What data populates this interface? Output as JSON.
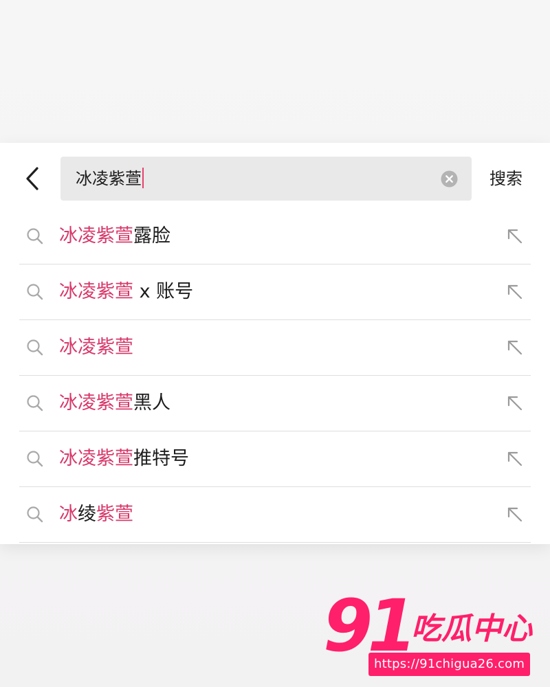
{
  "search": {
    "query": "冰凌紫萱",
    "submit_label": "搜索"
  },
  "suggestions": [
    {
      "segments": [
        {
          "text": "冰凌紫萱",
          "hl": true
        },
        {
          "text": "露脸",
          "hl": false
        }
      ]
    },
    {
      "segments": [
        {
          "text": "冰凌紫萱",
          "hl": true
        },
        {
          "text": " x 账号",
          "hl": false
        }
      ]
    },
    {
      "segments": [
        {
          "text": "冰凌紫萱",
          "hl": true
        }
      ]
    },
    {
      "segments": [
        {
          "text": "冰凌紫萱",
          "hl": true
        },
        {
          "text": "黑人",
          "hl": false
        }
      ]
    },
    {
      "segments": [
        {
          "text": "冰凌紫萱",
          "hl": true
        },
        {
          "text": "推特号",
          "hl": false
        }
      ]
    },
    {
      "segments": [
        {
          "text": "冰",
          "hl": true
        },
        {
          "text": "绫",
          "hl": false
        },
        {
          "text": "紫萱",
          "hl": true
        }
      ]
    }
  ],
  "watermark": {
    "logo_number": "91",
    "logo_text": "吃瓜中心",
    "url": "https://91chigua26.com"
  },
  "colors": {
    "highlight": "#d7386a",
    "text": "#1c1c1c",
    "field_bg": "#e9e9ea",
    "watermark": "#ff1f6b"
  },
  "icons": {
    "back": "chevron-left-icon",
    "clear": "clear-circle-icon",
    "search": "search-icon",
    "fill": "arrow-up-left-icon"
  }
}
